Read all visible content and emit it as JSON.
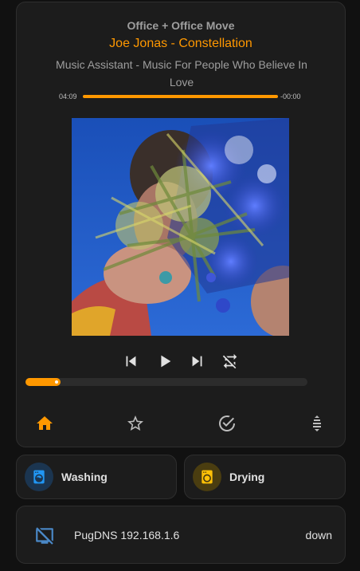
{
  "player": {
    "room": "Office + Office Move",
    "title": "Joe Jonas - Constellation",
    "artist": "Music Assistant - Music For People Who Believe In Love",
    "elapsed": "04:09",
    "remaining": "-00:00",
    "track_progress_fraction": 1.0,
    "volume_fraction": 0.12,
    "accent_color": "#ff9800",
    "controls": [
      "previous-track-icon",
      "play-icon",
      "next-track-icon",
      "repeat-off-icon"
    ],
    "nav": [
      "home-icon",
      "star-outline-icon",
      "check-circle-icon",
      "playlist-icon"
    ]
  },
  "tiles": [
    {
      "label": "Washing",
      "icon": "washing-machine-icon",
      "color": "#2196f3"
    },
    {
      "label": "Drying",
      "icon": "tumble-dryer-icon",
      "color": "#ffc107"
    }
  ],
  "dns": {
    "name": "PugDNS 192.168.1.6",
    "state": "down",
    "icon": "monitor-off-icon"
  }
}
